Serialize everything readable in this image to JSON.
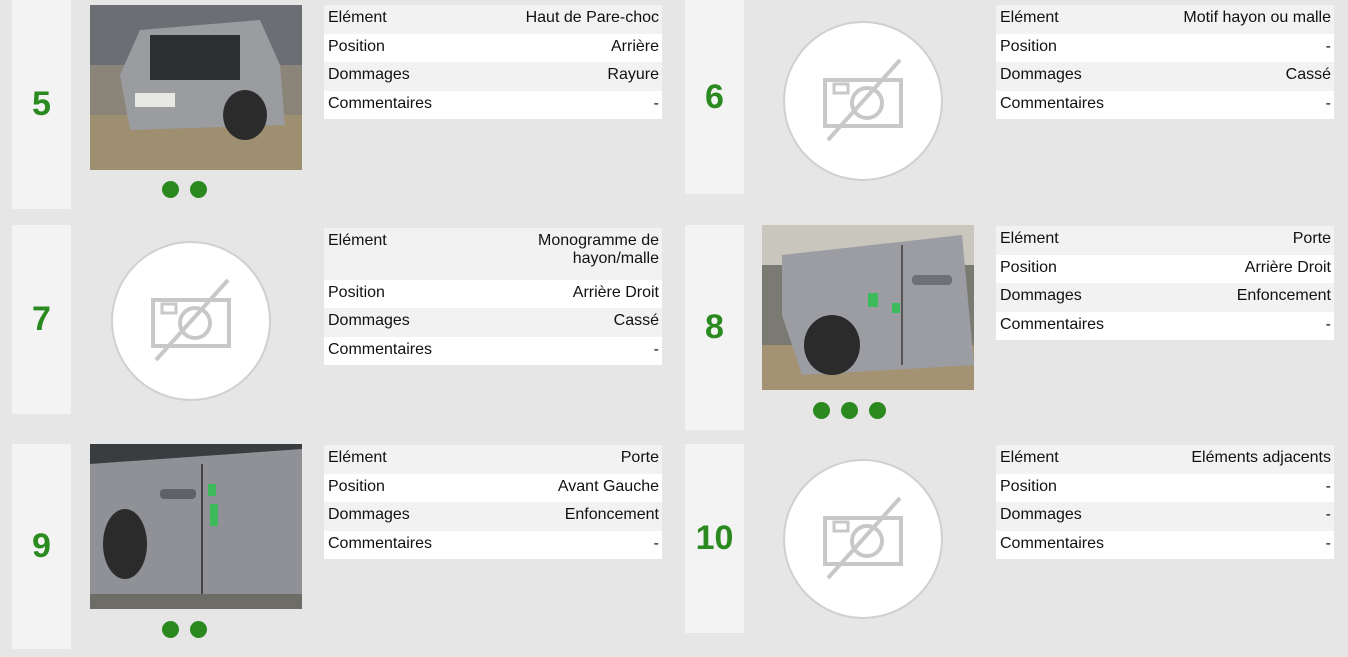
{
  "labels": {
    "element": "Elément",
    "position": "Position",
    "dommages": "Dommages",
    "commentaires": "Commentaires"
  },
  "cards": [
    {
      "number": "5",
      "element": "Haut de Pare-choc",
      "position": "Arrière",
      "dommages": "Rayure",
      "commentaires": "-",
      "photo_dots": 2
    },
    {
      "number": "6",
      "element": "Motif hayon ou malle",
      "position": "-",
      "dommages": "Cassé",
      "commentaires": "-",
      "photo_dots": 0
    },
    {
      "number": "7",
      "element": "Monogramme de hayon/malle",
      "position": "Arrière Droit",
      "dommages": "Cassé",
      "commentaires": "-",
      "photo_dots": 0
    },
    {
      "number": "8",
      "element": "Porte",
      "position": "Arrière Droit",
      "dommages": "Enfoncement",
      "commentaires": "-",
      "photo_dots": 3
    },
    {
      "number": "9",
      "element": "Porte",
      "position": "Avant Gauche",
      "dommages": "Enfoncement",
      "commentaires": "-",
      "photo_dots": 2
    },
    {
      "number": "10",
      "element": "Eléments adjacents",
      "position": "-",
      "dommages": "-",
      "commentaires": "-",
      "photo_dots": 0
    }
  ],
  "colors": {
    "accent": "#2a8a1f",
    "background": "#e6e6e6",
    "panel": "#f3f3f3"
  },
  "icons": {
    "no_photo": "camera-off-icon",
    "carousel_dot": "dot-icon"
  }
}
